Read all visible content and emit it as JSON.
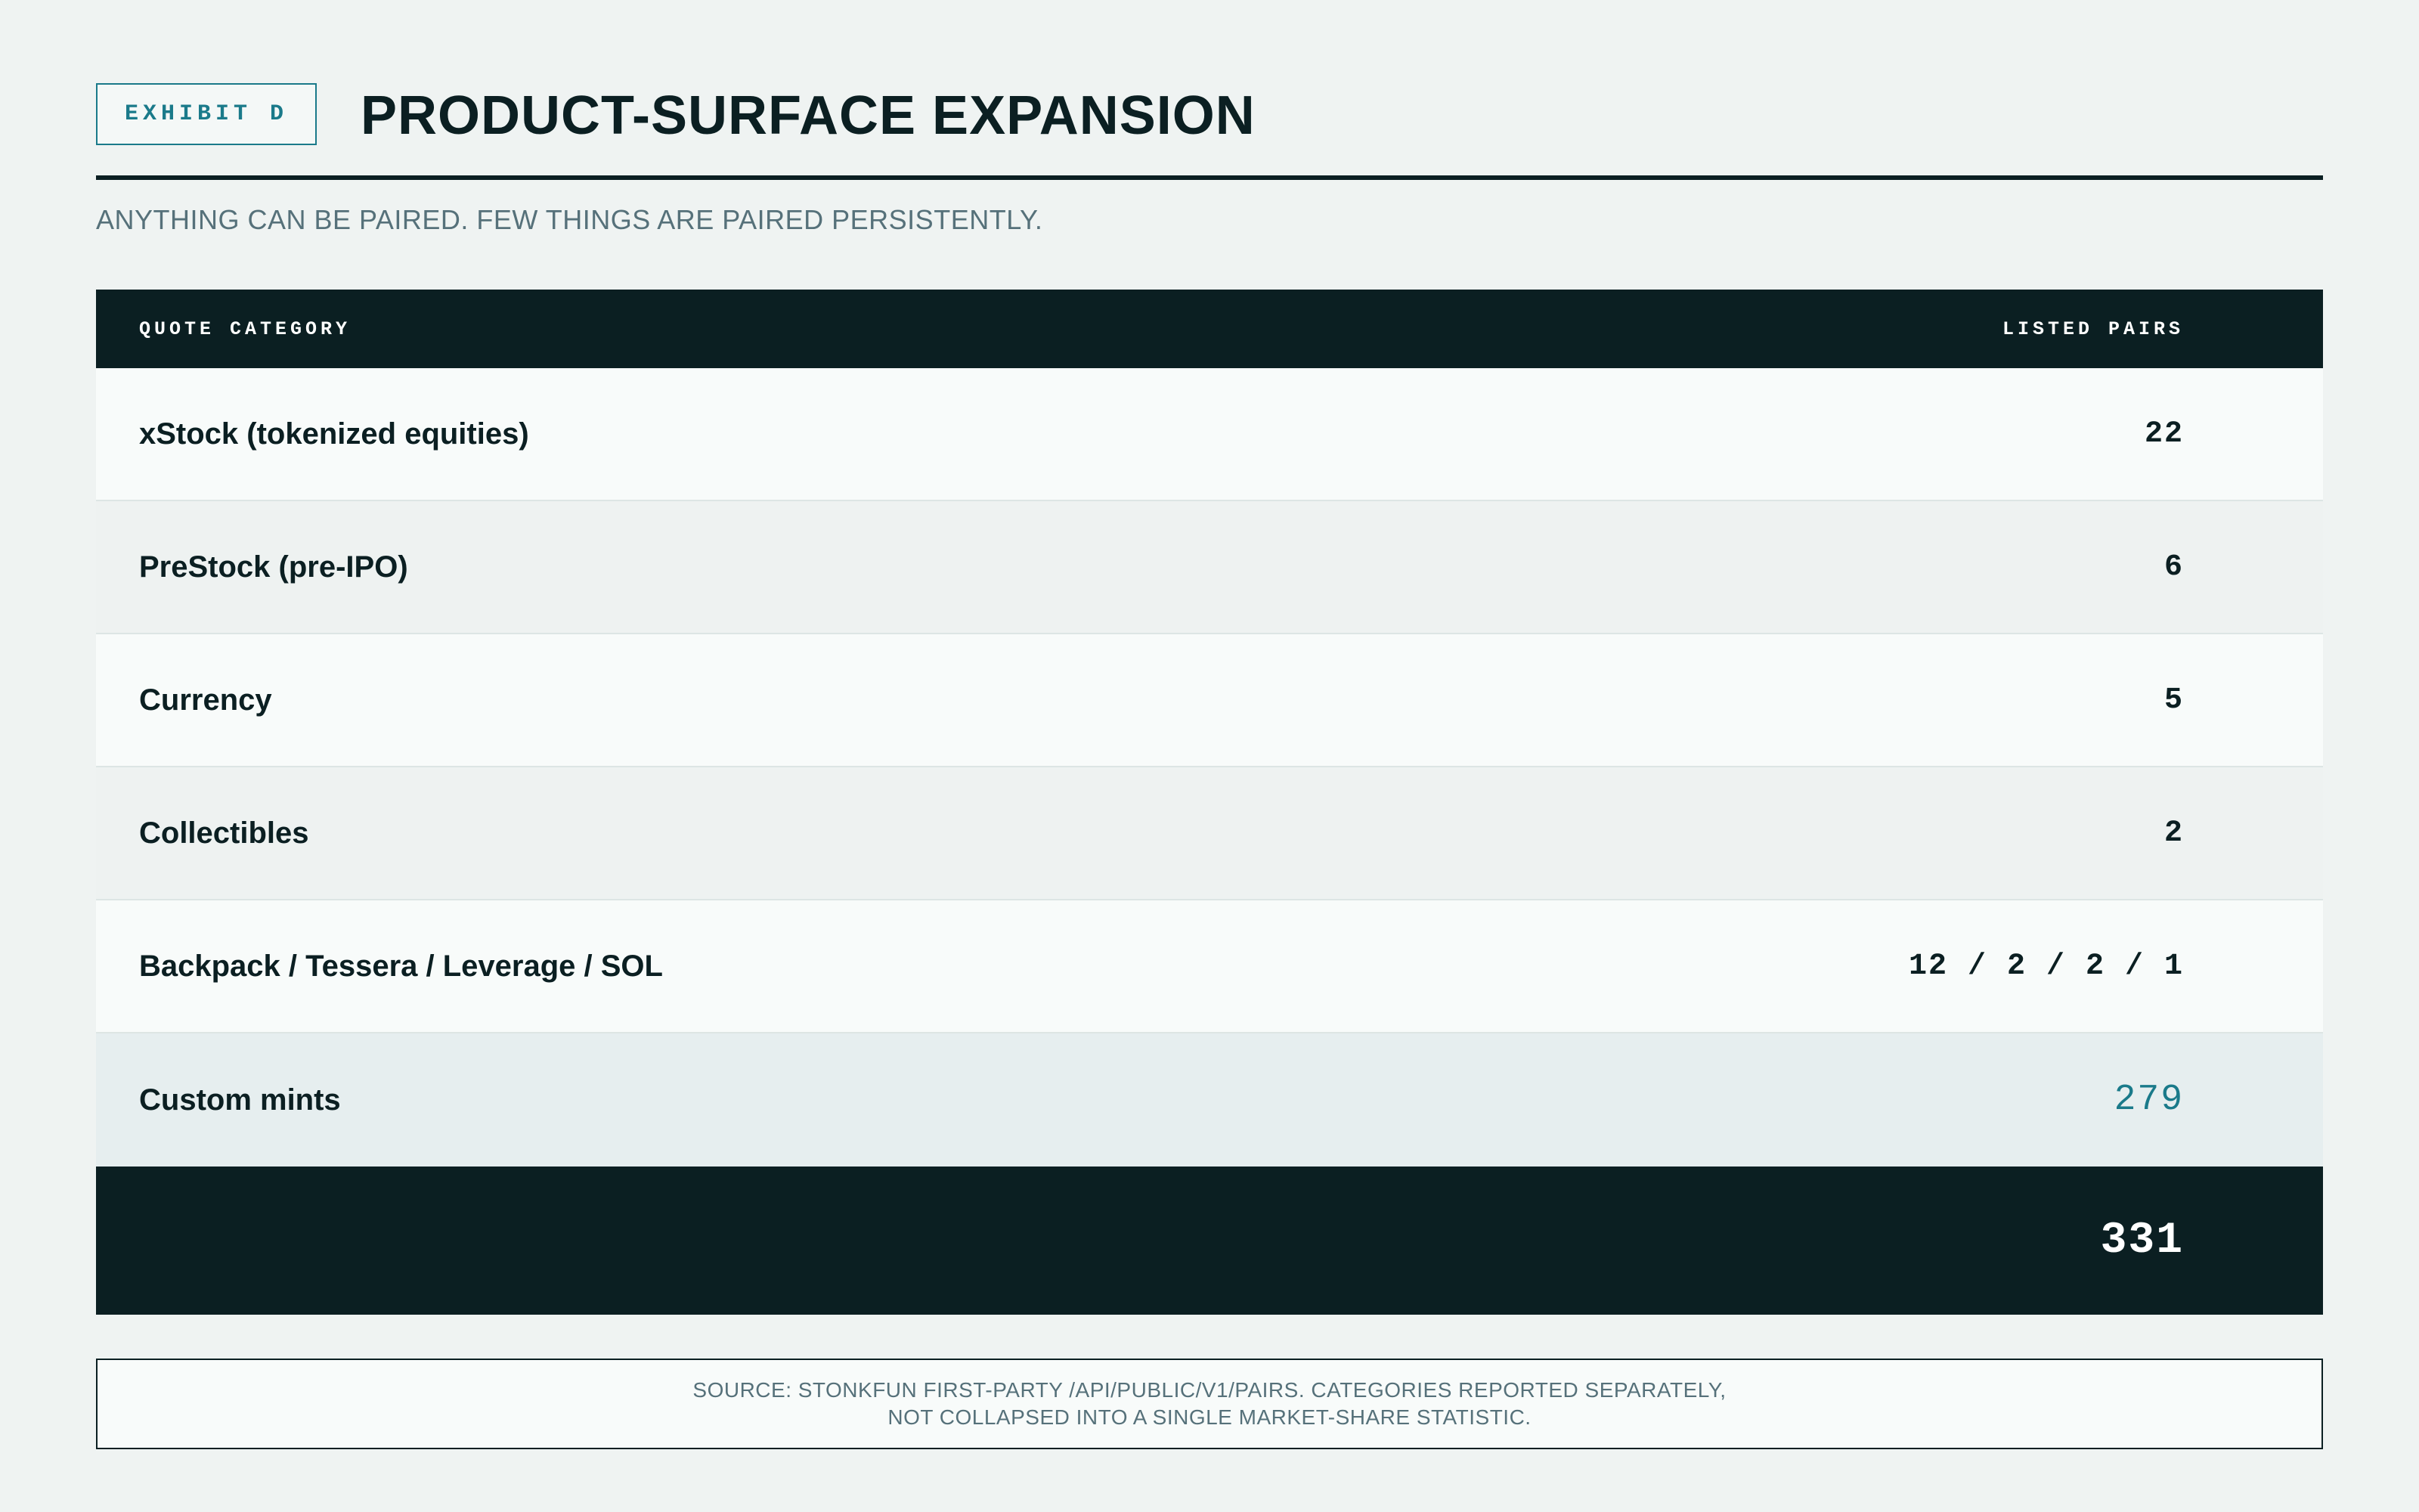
{
  "header": {
    "exhibit_label": "EXHIBIT D",
    "title": "PRODUCT-SURFACE EXPANSION",
    "subtitle": "ANYTHING CAN BE PAIRED. FEW THINGS ARE PAIRED PERSISTENTLY."
  },
  "table": {
    "columns": [
      "QUOTE CATEGORY",
      "LISTED PAIRS"
    ],
    "rows": [
      {
        "label": "xStock (tokenized equities)",
        "value": "22"
      },
      {
        "label": "PreStock (pre-IPO)",
        "value": "6"
      },
      {
        "label": "Currency",
        "value": "5"
      },
      {
        "label": "Collectibles",
        "value": "2"
      },
      {
        "label": "Backpack / Tessera / Leverage / SOL",
        "value": "12 / 2 / 2 / 1"
      },
      {
        "label": "Custom mints",
        "value": "279"
      }
    ],
    "total": "331"
  },
  "source": {
    "line1": "SOURCE: STONKFUN FIRST-PARTY /API/PUBLIC/V1/PAIRS. CATEGORIES REPORTED SEPARATELY,",
    "line2": "NOT COLLAPSED INTO A SINGLE MARKET-SHARE STATISTIC."
  },
  "colors": {
    "ink": "#0b1f22",
    "accent": "#1a7a8a",
    "muted": "#56717a",
    "background": "#eff3f2"
  }
}
